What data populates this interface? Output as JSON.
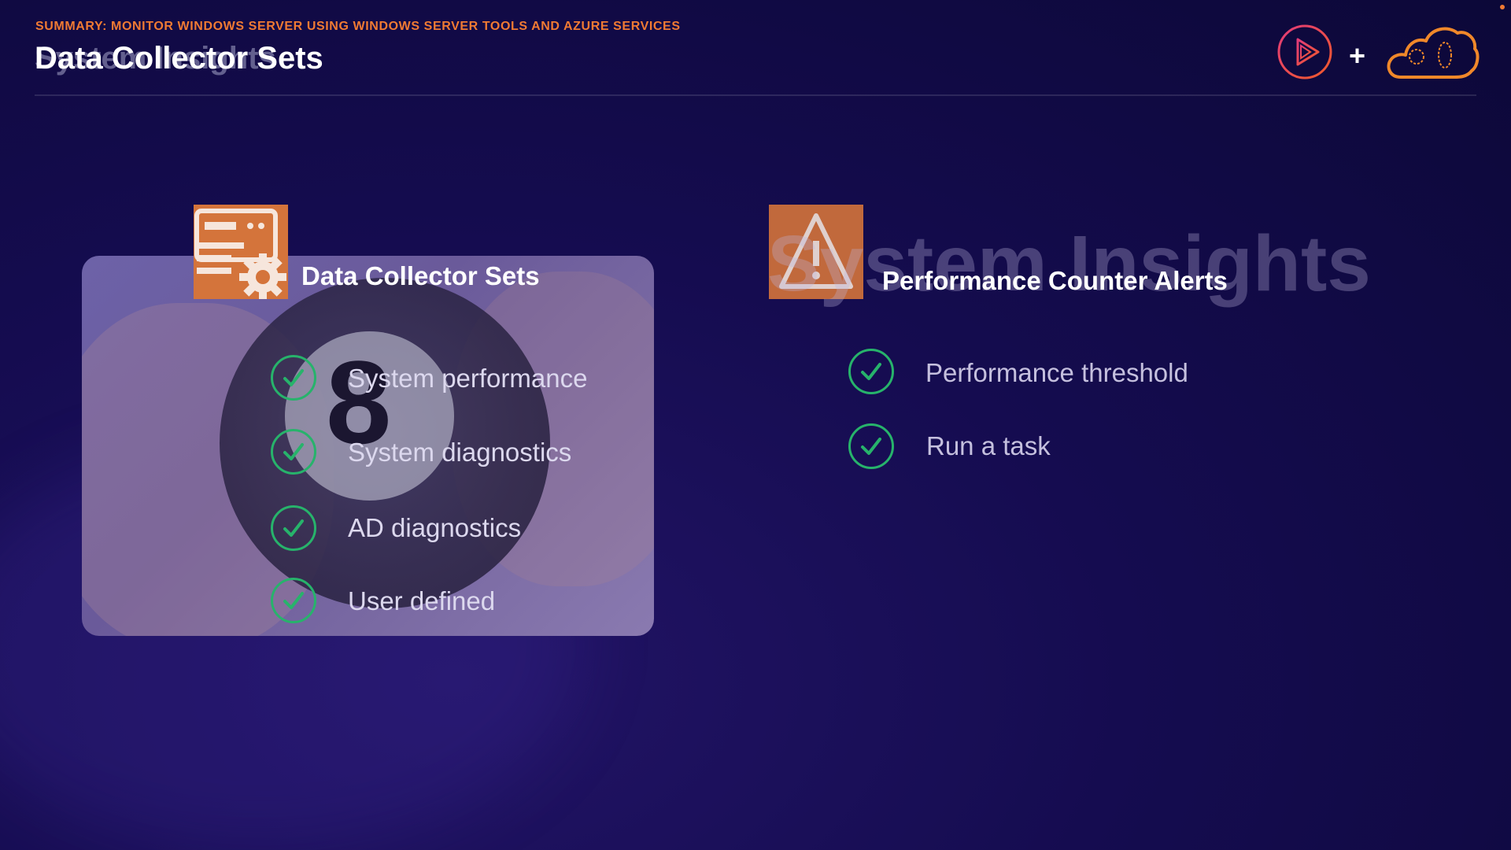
{
  "header": {
    "subtitle": "SUMMARY: MONITOR WINDOWS SERVER USING WINDOWS SERVER TOOLS AND AZURE SERVICES",
    "ghost_title": "System Insights",
    "title": "Data Collector Sets"
  },
  "logos": {
    "left": "play-logo-icon",
    "separator": "+",
    "right": "cloud-logo-icon"
  },
  "left_panel": {
    "title": "Data Collector Sets",
    "icon": "server-gear-icon",
    "background_text": "8",
    "items": [
      "System performance",
      "System diagnostics",
      "AD diagnostics",
      "User defined"
    ]
  },
  "right_panel": {
    "title": "Performance Counter Alerts",
    "ghost_text": "System Insights",
    "icon": "alert-triangle-icon",
    "items": [
      "Performance threshold",
      "Run a task"
    ]
  },
  "colors": {
    "accent": "#f07a33",
    "check": "#27b36b",
    "tile": "#d4743b",
    "background": "#150c50"
  }
}
